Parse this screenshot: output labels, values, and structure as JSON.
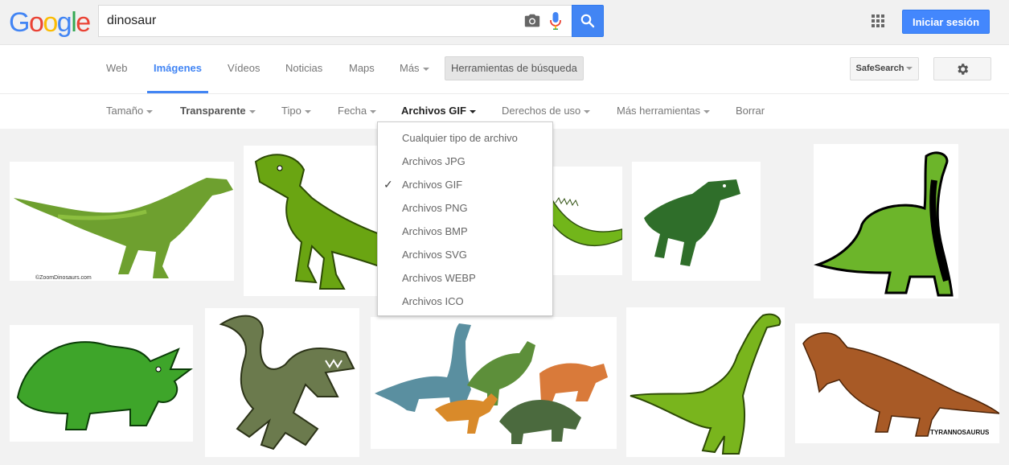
{
  "header": {
    "logo": "Google",
    "search_value": "dinosaur",
    "search_icons": [
      "camera-icon",
      "mic-icon",
      "search-icon"
    ],
    "signin_label": "Iniciar sesión",
    "accent": "#4285f4"
  },
  "nav": {
    "tabs": [
      {
        "label": "Web",
        "active": false
      },
      {
        "label": "Imágenes",
        "active": true
      },
      {
        "label": "Vídeos",
        "active": false
      },
      {
        "label": "Noticias",
        "active": false
      },
      {
        "label": "Maps",
        "active": false
      },
      {
        "label": "Más",
        "active": false
      }
    ],
    "tools_label": "Herramientas de búsqueda",
    "safesearch_label": "SafeSearch",
    "settings_icon": "gear-icon"
  },
  "tools": {
    "items": [
      {
        "label": "Tamaño"
      },
      {
        "label": "Transparente"
      },
      {
        "label": "Tipo"
      },
      {
        "label": "Fecha"
      },
      {
        "label": "Archivos GIF"
      },
      {
        "label": "Derechos de uso"
      },
      {
        "label": "Más herramientas"
      },
      {
        "label": "Borrar"
      }
    ]
  },
  "filetype_menu": {
    "items": [
      {
        "label": "Cualquier tipo de archivo",
        "checked": false
      },
      {
        "label": "Archivos JPG",
        "checked": false
      },
      {
        "label": "Archivos GIF",
        "checked": true
      },
      {
        "label": "Archivos PNG",
        "checked": false
      },
      {
        "label": "Archivos BMP",
        "checked": false
      },
      {
        "label": "Archivos SVG",
        "checked": false
      },
      {
        "label": "Archivos WEBP",
        "checked": false
      },
      {
        "label": "Archivos ICO",
        "checked": false
      }
    ]
  },
  "results": {
    "thumbnails": [
      {
        "caption": "©ZoomDinosaurs.com"
      },
      {
        "caption": ""
      },
      {
        "caption": ""
      },
      {
        "caption": ""
      },
      {
        "caption": ""
      },
      {
        "caption": ""
      },
      {
        "caption": ""
      },
      {
        "caption": ""
      },
      {
        "caption": ""
      },
      {
        "caption": "TYRANNOSAURUS"
      }
    ]
  }
}
